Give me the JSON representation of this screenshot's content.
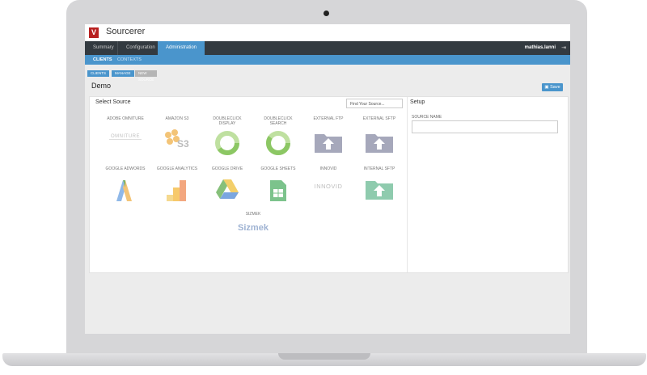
{
  "app": {
    "title": "Sourcerer",
    "logo_letter": "V"
  },
  "nav": {
    "tabs": [
      {
        "label": "Summary"
      },
      {
        "label": "Configuration"
      },
      {
        "label": "Administration"
      }
    ],
    "user": "mathias.lanni",
    "logout_icon": "logout-icon"
  },
  "subnav": {
    "tabs": [
      {
        "label": "CLIENTS"
      },
      {
        "label": "CONTEXTS"
      }
    ]
  },
  "breadcrumb": [
    {
      "label": "CLIENTS"
    },
    {
      "label": "MANAGE"
    },
    {
      "label": "NEW SOURCE"
    }
  ],
  "page": {
    "title": "Demo",
    "save_label": "Save",
    "save_icon": "floppy-disk-icon"
  },
  "select_source": {
    "title": "Select Source",
    "search_placeholder": "Find Your Source...",
    "sources": [
      {
        "label": "ADOBE OMNITURE",
        "icon": "adobe-omniture-logo",
        "logo_text": "OMNITURE"
      },
      {
        "label": "AMAZON S3",
        "icon": "amazon-s3-logo",
        "logo_text": "S3"
      },
      {
        "label": "DOUBLECLICK DISPLAY",
        "icon": "doubleclick-display-logo"
      },
      {
        "label": "DOUBLECLICK SEARCH",
        "icon": "doubleclick-search-logo"
      },
      {
        "label": "EXTERNAL FTP",
        "icon": "ftp-folder-icon"
      },
      {
        "label": "EXTERNAL SFTP",
        "icon": "sftp-folder-icon"
      },
      {
        "label": "GOOGLE ADWORDS",
        "icon": "google-adwords-logo"
      },
      {
        "label": "GOOGLE ANALYTICS",
        "icon": "google-analytics-logo"
      },
      {
        "label": "GOOGLE DRIVE",
        "icon": "google-drive-logo"
      },
      {
        "label": "GOOGLE SHEETS",
        "icon": "google-sheets-logo"
      },
      {
        "label": "INNOVID",
        "icon": "innovid-logo",
        "logo_text": "INNOVID"
      },
      {
        "label": "INTERNAL SFTP",
        "icon": "internal-sftp-folder-icon"
      },
      {
        "label": "SIZMEK",
        "icon": "sizmek-logo",
        "logo_text": "Sizmek"
      }
    ]
  },
  "setup": {
    "title": "Setup",
    "source_name_label": "SOURCE NAME",
    "source_name_value": ""
  },
  "colors": {
    "nav_dark": "#333a40",
    "accent_blue": "#4a95cc",
    "brand_red": "#b82020"
  }
}
